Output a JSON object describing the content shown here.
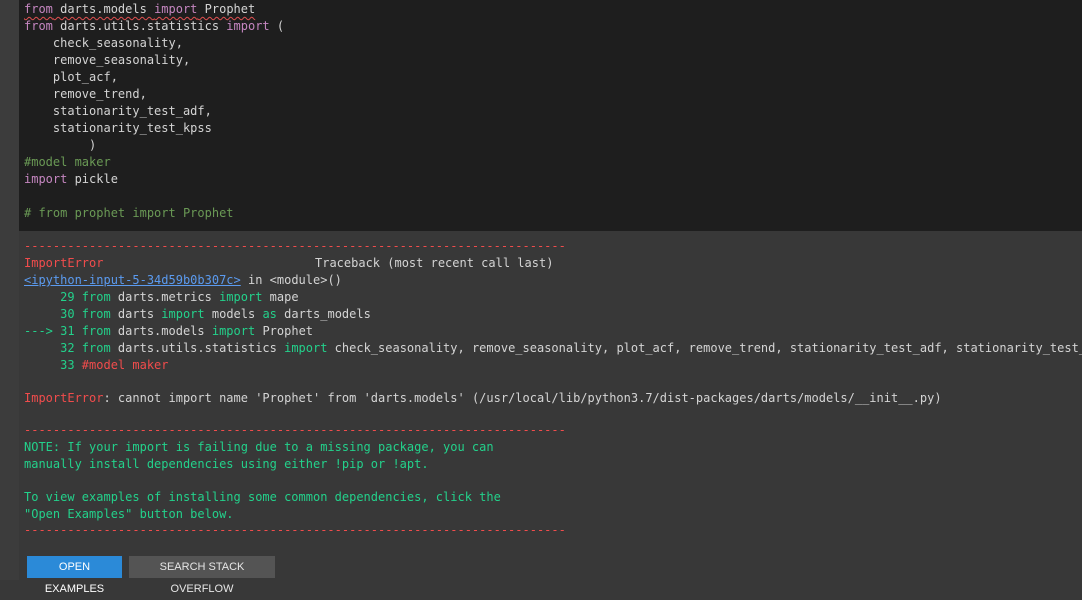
{
  "code": {
    "line1": {
      "kw1": "from",
      "mod": " darts.models ",
      "kw2": "import",
      "name": " Prophet"
    },
    "line2": {
      "kw1": "from",
      "mod": " darts.utils.statistics ",
      "kw2": "import",
      "rest": " ("
    },
    "imports": [
      "    check_seasonality,",
      "    remove_seasonality,",
      "    plot_acf,",
      "    remove_trend,",
      "    stationarity_test_adf,",
      "    stationarity_test_kpss"
    ],
    "close_paren": "         )",
    "comment_model": "#model maker",
    "line_pickle": {
      "kw": "import",
      "name": " pickle"
    },
    "comment_prophet": "# from prophet import Prophet"
  },
  "output": {
    "dashes": "---------------------------------------------------------------------------",
    "error_name": "ImportError",
    "traceback_header": "Traceback (most recent call last)",
    "link": "<ipython-input-5-34d59b0b307c>",
    "in_module": " in <module>()",
    "tb_lines": [
      {
        "prefix": "     29 ",
        "t1": "from",
        "t2": " darts.metrics ",
        "t3": "import",
        "t4": " mape"
      },
      {
        "prefix": "     30 ",
        "t1": "from",
        "t2": " darts ",
        "t3": "import",
        "t4": " models ",
        "t5": "as",
        "t6": " darts_models"
      },
      {
        "prefix": "---> 31 ",
        "t1": "from",
        "t2": " darts.models ",
        "t3": "import",
        "t4": " Prophet"
      },
      {
        "prefix": "     32 ",
        "t1": "from",
        "t2": " darts.utils.statistics ",
        "t3": "import",
        "t4": " check_seasonality, remove_seasonality, plot_acf, remove_trend, stationarity_test_adf, stationarity_test_kpss"
      }
    ],
    "tb_line33_prefix": "     33 ",
    "tb_line33_comment": "#model maker",
    "error_message": ": cannot import name 'Prophet' from 'darts.models' (/usr/local/lib/python3.7/dist-packages/darts/models/__init__.py)",
    "note_lines": [
      "NOTE: If your import is failing due to a missing package, you can",
      "manually install dependencies using either !pip or !apt.",
      "",
      "To view examples of installing some common dependencies, click the",
      "\"Open Examples\" button below."
    ]
  },
  "buttons": {
    "open_examples": "OPEN EXAMPLES",
    "search_so": "SEARCH STACK OVERFLOW"
  }
}
